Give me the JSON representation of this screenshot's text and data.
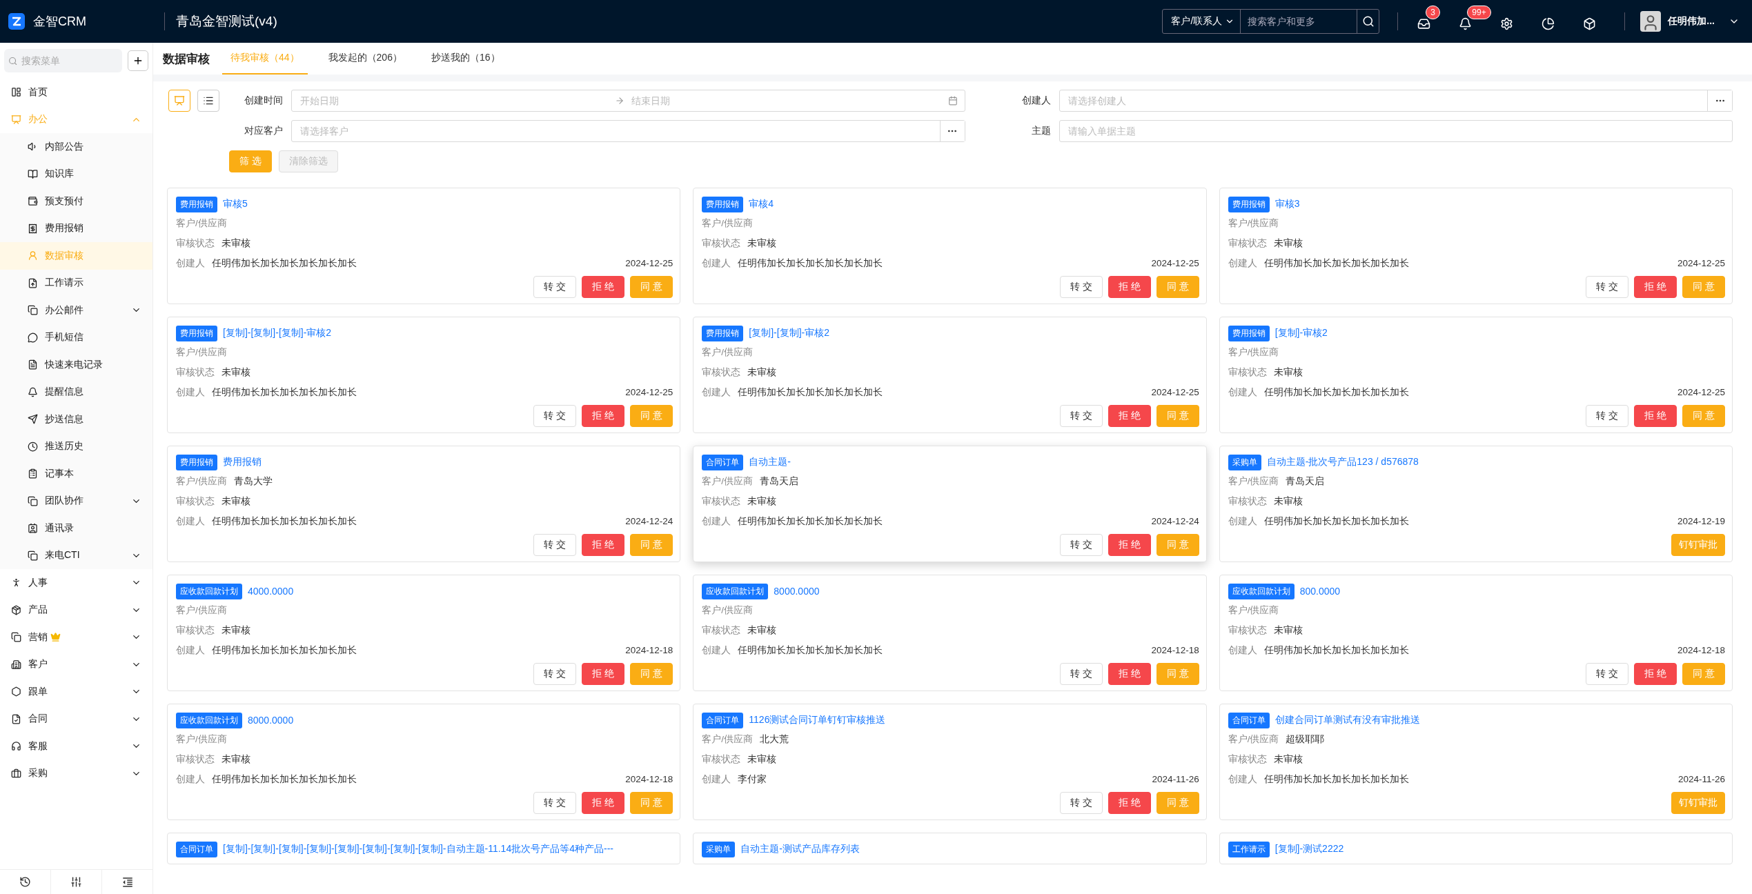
{
  "topbar": {
    "brand": "金智CRM",
    "company": "青岛金智测试(v4)",
    "search_scope": "客户/联系人",
    "search_placeholder": "搜索客户和更多",
    "icons": [
      {
        "kind": "inbox",
        "count": "3"
      },
      {
        "kind": "bell",
        "count": "99+"
      },
      {
        "kind": "settings"
      },
      {
        "kind": "chart"
      },
      {
        "kind": "cube"
      }
    ],
    "user": "任明伟加..."
  },
  "sidebar": {
    "search_placeholder": "搜索菜单",
    "items": [
      {
        "label": "首页",
        "kind": "link",
        "selected": false,
        "crown": false
      },
      {
        "label": "办公",
        "kind": "group",
        "expanded": true,
        "selected": false,
        "crown": false,
        "children": [
          {
            "label": "内部公告",
            "kind": "link",
            "selected": false
          },
          {
            "label": "知识库",
            "kind": "link",
            "selected": false
          },
          {
            "label": "预支预付",
            "kind": "link",
            "selected": false
          },
          {
            "label": "费用报销",
            "kind": "link",
            "selected": false
          },
          {
            "label": "数据审核",
            "kind": "link",
            "selected": true
          },
          {
            "label": "工作请示",
            "kind": "link",
            "selected": false
          },
          {
            "label": "办公邮件",
            "kind": "group",
            "expanded": false,
            "selected": false
          },
          {
            "label": "手机短信",
            "kind": "link",
            "selected": false
          },
          {
            "label": "快速来电记录",
            "kind": "link",
            "selected": false
          },
          {
            "label": "提醒信息",
            "kind": "link",
            "selected": false
          },
          {
            "label": "抄送信息",
            "kind": "link",
            "selected": false
          },
          {
            "label": "推送历史",
            "kind": "link",
            "selected": false
          },
          {
            "label": "记事本",
            "kind": "link",
            "selected": false
          },
          {
            "label": "团队协作",
            "kind": "group",
            "expanded": false,
            "selected": false
          },
          {
            "label": "通讯录",
            "kind": "link",
            "selected": false
          },
          {
            "label": "来电CTI",
            "kind": "group",
            "expanded": false,
            "selected": false
          }
        ]
      },
      {
        "label": "人事",
        "kind": "group",
        "expanded": false,
        "selected": false,
        "crown": false
      },
      {
        "label": "产品",
        "kind": "group",
        "expanded": false,
        "selected": false,
        "crown": false
      },
      {
        "label": "营销",
        "kind": "group",
        "expanded": false,
        "selected": false,
        "crown": true
      },
      {
        "label": "客户",
        "kind": "group",
        "expanded": false,
        "selected": false,
        "crown": false
      },
      {
        "label": "跟单",
        "kind": "group",
        "expanded": false,
        "selected": false,
        "crown": false
      },
      {
        "label": "合同",
        "kind": "group",
        "expanded": false,
        "selected": false,
        "crown": false
      },
      {
        "label": "客服",
        "kind": "group",
        "expanded": false,
        "selected": false,
        "crown": false
      },
      {
        "label": "采购",
        "kind": "group",
        "expanded": false,
        "selected": false,
        "crown": false
      }
    ]
  },
  "page": {
    "title": "数据审核",
    "tabs": [
      {
        "label": "待我审核（44）",
        "selected": true
      },
      {
        "label": "我发起的（206）",
        "selected": false
      },
      {
        "label": "抄送我的（16）",
        "selected": false
      }
    ]
  },
  "filters": {
    "views": [
      {
        "kind": "card",
        "selected": true
      },
      {
        "kind": "list",
        "selected": false
      }
    ],
    "fields": [
      {
        "label": "创建时间",
        "kind": "daterange",
        "start_placeholder": "开始日期",
        "end_placeholder": "结束日期"
      },
      {
        "label": "创建人",
        "kind": "picker",
        "placeholder": "请选择创建人"
      },
      {
        "label": "对应客户",
        "kind": "picker",
        "placeholder": "请选择客户"
      },
      {
        "label": "主题",
        "kind": "text",
        "placeholder": "请输入单据主题"
      }
    ],
    "buttons": [
      {
        "label": "筛 选",
        "kind": "primary",
        "disabled": false
      },
      {
        "label": "清除筛选",
        "kind": "default",
        "disabled": true
      }
    ]
  },
  "cards": [
    {
      "tag": "费用报销",
      "title": "审核5",
      "highlighted": false,
      "fields": [
        {
          "label": "客户/供应商"
        },
        {
          "label": "审核状态",
          "value": "未审核"
        },
        {
          "label": "创建人",
          "value": "任明伟加长加长加长加长加长加长"
        }
      ],
      "date": "2024-12-25",
      "actions": [
        {
          "label": "转 交",
          "kind": "transfer"
        },
        {
          "label": "拒 绝",
          "kind": "reject"
        },
        {
          "label": "同 意",
          "kind": "agree"
        }
      ]
    },
    {
      "tag": "费用报销",
      "title": "审核4",
      "highlighted": false,
      "fields": [
        {
          "label": "客户/供应商"
        },
        {
          "label": "审核状态",
          "value": "未审核"
        },
        {
          "label": "创建人",
          "value": "任明伟加长加长加长加长加长加长"
        }
      ],
      "date": "2024-12-25",
      "actions": [
        {
          "label": "转 交",
          "kind": "transfer"
        },
        {
          "label": "拒 绝",
          "kind": "reject"
        },
        {
          "label": "同 意",
          "kind": "agree"
        }
      ]
    },
    {
      "tag": "费用报销",
      "title": "审核3",
      "highlighted": false,
      "fields": [
        {
          "label": "客户/供应商"
        },
        {
          "label": "审核状态",
          "value": "未审核"
        },
        {
          "label": "创建人",
          "value": "任明伟加长加长加长加长加长加长"
        }
      ],
      "date": "2024-12-25",
      "actions": [
        {
          "label": "转 交",
          "kind": "transfer"
        },
        {
          "label": "拒 绝",
          "kind": "reject"
        },
        {
          "label": "同 意",
          "kind": "agree"
        }
      ]
    },
    {
      "tag": "费用报销",
      "title": "[复制]-[复制]-[复制]-审核2",
      "highlighted": false,
      "fields": [
        {
          "label": "客户/供应商"
        },
        {
          "label": "审核状态",
          "value": "未审核"
        },
        {
          "label": "创建人",
          "value": "任明伟加长加长加长加长加长加长"
        }
      ],
      "date": "2024-12-25",
      "actions": [
        {
          "label": "转 交",
          "kind": "transfer"
        },
        {
          "label": "拒 绝",
          "kind": "reject"
        },
        {
          "label": "同 意",
          "kind": "agree"
        }
      ]
    },
    {
      "tag": "费用报销",
      "title": "[复制]-[复制]-审核2",
      "highlighted": false,
      "fields": [
        {
          "label": "客户/供应商"
        },
        {
          "label": "审核状态",
          "value": "未审核"
        },
        {
          "label": "创建人",
          "value": "任明伟加长加长加长加长加长加长"
        }
      ],
      "date": "2024-12-25",
      "actions": [
        {
          "label": "转 交",
          "kind": "transfer"
        },
        {
          "label": "拒 绝",
          "kind": "reject"
        },
        {
          "label": "同 意",
          "kind": "agree"
        }
      ]
    },
    {
      "tag": "费用报销",
      "title": "[复制]-审核2",
      "highlighted": false,
      "fields": [
        {
          "label": "客户/供应商"
        },
        {
          "label": "审核状态",
          "value": "未审核"
        },
        {
          "label": "创建人",
          "value": "任明伟加长加长加长加长加长加长"
        }
      ],
      "date": "2024-12-25",
      "actions": [
        {
          "label": "转 交",
          "kind": "transfer"
        },
        {
          "label": "拒 绝",
          "kind": "reject"
        },
        {
          "label": "同 意",
          "kind": "agree"
        }
      ]
    },
    {
      "tag": "费用报销",
      "title": "费用报销",
      "highlighted": false,
      "fields": [
        {
          "label": "客户/供应商",
          "value": "青岛大学"
        },
        {
          "label": "审核状态",
          "value": "未审核"
        },
        {
          "label": "创建人",
          "value": "任明伟加长加长加长加长加长加长"
        }
      ],
      "date": "2024-12-24",
      "actions": [
        {
          "label": "转 交",
          "kind": "transfer"
        },
        {
          "label": "拒 绝",
          "kind": "reject"
        },
        {
          "label": "同 意",
          "kind": "agree"
        }
      ]
    },
    {
      "tag": "合同订单",
      "title": "自动主题-",
      "highlighted": true,
      "fields": [
        {
          "label": "客户/供应商",
          "value": "青岛天启"
        },
        {
          "label": "审核状态",
          "value": "未审核"
        },
        {
          "label": "创建人",
          "value": "任明伟加长加长加长加长加长加长"
        }
      ],
      "date": "2024-12-24",
      "actions": [
        {
          "label": "转 交",
          "kind": "transfer"
        },
        {
          "label": "拒 绝",
          "kind": "reject"
        },
        {
          "label": "同 意",
          "kind": "agree"
        }
      ]
    },
    {
      "tag": "采购单",
      "title": "自动主题-批次号产品123 / d576878",
      "highlighted": false,
      "fields": [
        {
          "label": "客户/供应商",
          "value": "青岛天启"
        },
        {
          "label": "审核状态",
          "value": "未审核"
        },
        {
          "label": "创建人",
          "value": "任明伟加长加长加长加长加长加长"
        }
      ],
      "date": "2024-12-19",
      "actions": [
        {
          "label": "钉钉审批",
          "kind": "agree"
        }
      ]
    },
    {
      "tag": "应收款回款计划",
      "title": "4000.0000",
      "highlighted": false,
      "fields": [
        {
          "label": "客户/供应商"
        },
        {
          "label": "审核状态",
          "value": "未审核"
        },
        {
          "label": "创建人",
          "value": "任明伟加长加长加长加长加长加长"
        }
      ],
      "date": "2024-12-18",
      "actions": [
        {
          "label": "转 交",
          "kind": "transfer"
        },
        {
          "label": "拒 绝",
          "kind": "reject"
        },
        {
          "label": "同 意",
          "kind": "agree"
        }
      ]
    },
    {
      "tag": "应收款回款计划",
      "title": "8000.0000",
      "highlighted": false,
      "fields": [
        {
          "label": "客户/供应商"
        },
        {
          "label": "审核状态",
          "value": "未审核"
        },
        {
          "label": "创建人",
          "value": "任明伟加长加长加长加长加长加长"
        }
      ],
      "date": "2024-12-18",
      "actions": [
        {
          "label": "转 交",
          "kind": "transfer"
        },
        {
          "label": "拒 绝",
          "kind": "reject"
        },
        {
          "label": "同 意",
          "kind": "agree"
        }
      ]
    },
    {
      "tag": "应收款回款计划",
      "title": "800.0000",
      "highlighted": false,
      "fields": [
        {
          "label": "客户/供应商"
        },
        {
          "label": "审核状态",
          "value": "未审核"
        },
        {
          "label": "创建人",
          "value": "任明伟加长加长加长加长加长加长"
        }
      ],
      "date": "2024-12-18",
      "actions": [
        {
          "label": "转 交",
          "kind": "transfer"
        },
        {
          "label": "拒 绝",
          "kind": "reject"
        },
        {
          "label": "同 意",
          "kind": "agree"
        }
      ]
    },
    {
      "tag": "应收款回款计划",
      "title": "8000.0000",
      "highlighted": false,
      "fields": [
        {
          "label": "客户/供应商"
        },
        {
          "label": "审核状态",
          "value": "未审核"
        },
        {
          "label": "创建人",
          "value": "任明伟加长加长加长加长加长加长"
        }
      ],
      "date": "2024-12-18",
      "actions": [
        {
          "label": "转 交",
          "kind": "transfer"
        },
        {
          "label": "拒 绝",
          "kind": "reject"
        },
        {
          "label": "同 意",
          "kind": "agree"
        }
      ]
    },
    {
      "tag": "合同订单",
      "title": "1126测试合同订单钉钉审核推送",
      "highlighted": false,
      "fields": [
        {
          "label": "客户/供应商",
          "value": "北大荒"
        },
        {
          "label": "审核状态",
          "value": "未审核"
        },
        {
          "label": "创建人",
          "value": "李付家"
        }
      ],
      "date": "2024-11-26",
      "actions": [
        {
          "label": "转 交",
          "kind": "transfer"
        },
        {
          "label": "拒 绝",
          "kind": "reject"
        },
        {
          "label": "同 意",
          "kind": "agree"
        }
      ]
    },
    {
      "tag": "合同订单",
      "title": "创建合同订单测试有没有审批推送",
      "highlighted": false,
      "fields": [
        {
          "label": "客户/供应商",
          "value": "超级耶耶"
        },
        {
          "label": "审核状态",
          "value": "未审核"
        },
        {
          "label": "创建人",
          "value": "任明伟加长加长加长加长加长加长"
        }
      ],
      "date": "2024-11-26",
      "actions": [
        {
          "label": "钉钉审批",
          "kind": "agree"
        }
      ]
    },
    {
      "tag": "合同订单",
      "title": "[复制]-[复制]-[复制]-[复制]-[复制]-[复制]-[复制]-[复制]-自动主题-11.14批次号产品等4种产品---",
      "highlighted": false
    },
    {
      "tag": "采购单",
      "title": "自动主题-测试产品库存列表",
      "highlighted": false
    },
    {
      "tag": "工作请示",
      "title": "[复制]-测试2222",
      "highlighted": false
    }
  ]
}
